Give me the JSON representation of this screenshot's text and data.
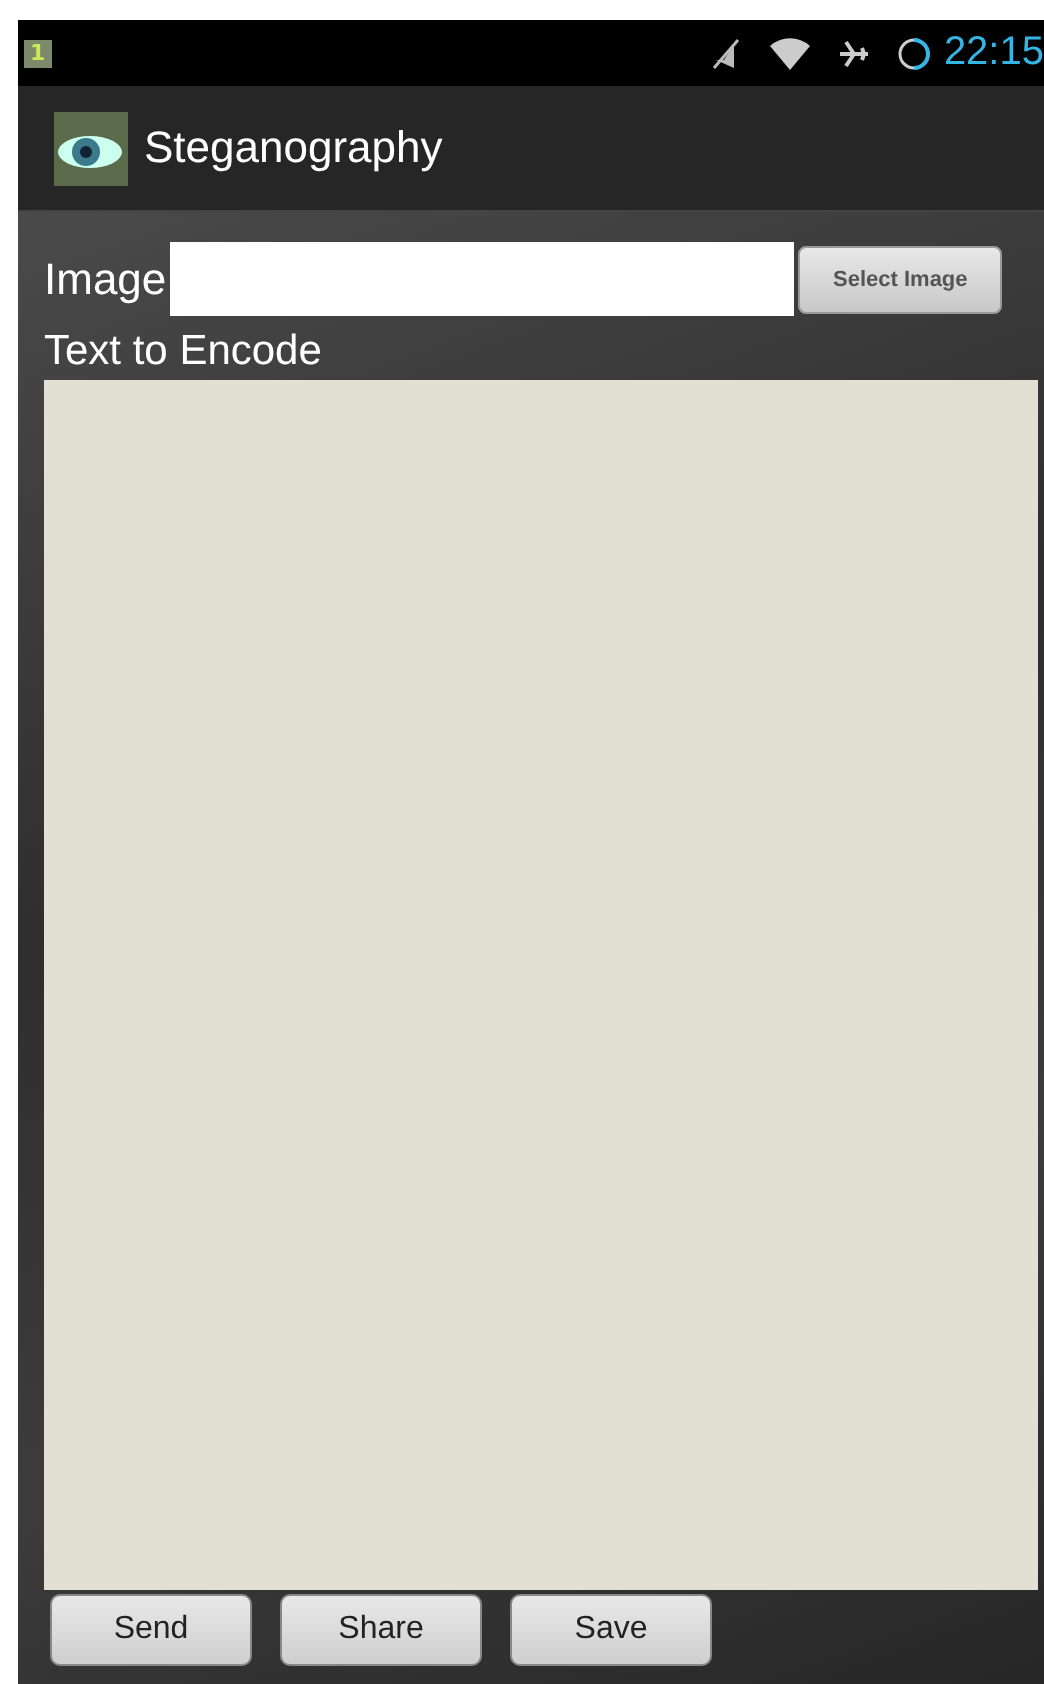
{
  "status_bar": {
    "notification": "1",
    "time": "22:15"
  },
  "action_bar": {
    "title": "Steganography"
  },
  "image_row": {
    "label": "Image",
    "button": "Select Image"
  },
  "text_section": {
    "label": "Text to Encode"
  },
  "buttons": [
    "Send",
    "Share",
    "Save"
  ]
}
